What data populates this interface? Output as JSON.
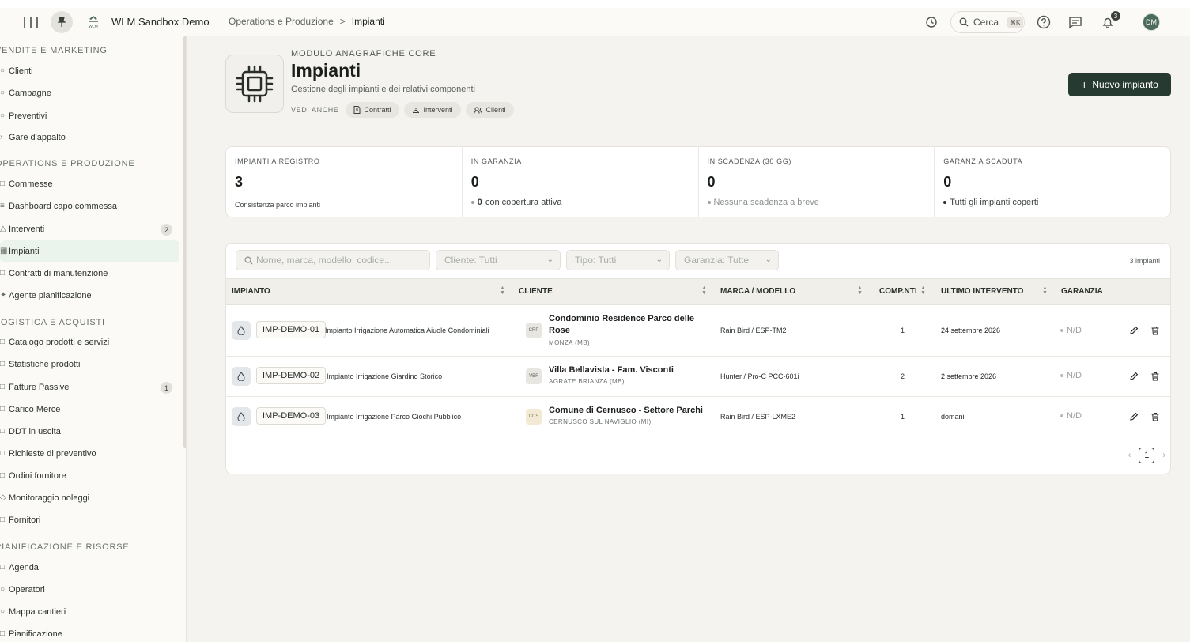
{
  "topbar": {
    "app_name": "WLM Sandbox Demo",
    "breadcrumb": [
      "Operations e Produzione",
      "Impianti"
    ],
    "breadcrumb_sep": ">",
    "search_label": "Cerca",
    "search_kbd": "⌘K",
    "notifications_count": "3",
    "avatar_initials": "DM",
    "icons": [
      "sidebar-toggle-icon",
      "pin-icon",
      "logo",
      "history-icon",
      "search-icon",
      "help-icon",
      "chat-icon",
      "bell-icon"
    ]
  },
  "sidebar": {
    "sections": [
      {
        "title": "VENDITE E MARKETING",
        "items": [
          {
            "label": "Clienti"
          },
          {
            "label": "Campagne"
          },
          {
            "label": "Preventivi"
          },
          {
            "label": "Gare d'appalto"
          }
        ]
      },
      {
        "title": "OPERATIONS E PRODUZIONE",
        "items": [
          {
            "label": "Commesse"
          },
          {
            "label": "Dashboard capo commessa"
          },
          {
            "label": "Interventi",
            "badge": "2"
          },
          {
            "label": "Impianti",
            "active": true
          },
          {
            "label": "Contratti di manutenzione"
          },
          {
            "label": "Agente pianificazione"
          }
        ]
      },
      {
        "title": "LOGISTICA E ACQUISTI",
        "items": [
          {
            "label": "Catalogo prodotti e servizi"
          },
          {
            "label": "Statistiche prodotti"
          },
          {
            "label": "Fatture Passive",
            "badge": "1"
          },
          {
            "label": "Carico Merce"
          },
          {
            "label": "DDT in uscita"
          },
          {
            "label": "Richieste di preventivo"
          },
          {
            "label": "Ordini fornitore"
          },
          {
            "label": "Monitoraggio noleggi"
          },
          {
            "label": "Fornitori"
          }
        ]
      },
      {
        "title": "PIANIFICAZIONE E RISORSE",
        "items": [
          {
            "label": "Agenda"
          },
          {
            "label": "Operatori"
          },
          {
            "label": "Mappa cantieri"
          },
          {
            "label": "Pianificazione"
          }
        ]
      }
    ]
  },
  "header": {
    "eyebrow": "MODULO ANAGRAFICHE CORE",
    "title": "Impianti",
    "subtitle": "Gestione degli impianti e dei relativi componenti",
    "see_also_label": "VEDI ANCHE",
    "see_also": [
      "Contratti",
      "Interventi",
      "Clienti"
    ],
    "new_button": "Nuovo impianto",
    "new_button_prefix": "+"
  },
  "kpis": [
    {
      "label": "IMPIANTI A REGISTRO",
      "value": "3",
      "note": "Consistenza parco impianti"
    },
    {
      "label": "IN GARANZIA",
      "value": "0",
      "note_strong": "0",
      "note": "con copertura attiva"
    },
    {
      "label": "IN SCADENZA (30 GG)",
      "value": "0",
      "note": "Nessuna scadenza a breve"
    },
    {
      "label": "GARANZIA SCADUTA",
      "value": "0",
      "note": "Tutti gli impianti coperti"
    }
  ],
  "filters": {
    "search_placeholder": "Nome, marca, modello, codice...",
    "cliente": "Cliente: Tutti",
    "tipo": "Tipo: Tutti",
    "garanzia": "Garanzia: Tutte",
    "count": "3 impianti"
  },
  "table": {
    "headers": [
      "IMPIANTO",
      "CLIENTE",
      "MARCA / MODELLO",
      "COMP.NTI",
      "ULTIMO INTERVENTO",
      "GARANZIA"
    ],
    "rows": [
      {
        "code": "IMP-DEMO-01",
        "name": "Impianto Irrigazione Automatica Aiuole Condominiali",
        "client_badge": "CRP",
        "client": "Condominio Residence Parco delle Rose",
        "location": "MONZA (MB)",
        "brand": "Rain Bird / ESP-TM2",
        "comp": "1",
        "last": "24 settembre 2026",
        "warranty": "N/D"
      },
      {
        "code": "IMP-DEMO-02",
        "name": "Impianto Irrigazione Giardino Storico",
        "client_badge": "VBF",
        "client": "Villa Bellavista - Fam. Visconti",
        "location": "AGRATE BRIANZA (MB)",
        "brand": "Hunter / Pro-C PCC-601i",
        "comp": "2",
        "last": "2 settembre 2026",
        "warranty": "N/D"
      },
      {
        "code": "IMP-DEMO-03",
        "name": "Impianto Irrigazione Parco Giochi Pubblico",
        "client_badge": "CCS",
        "client": "Comune di Cernusco - Settore Parchi",
        "location": "CERNUSCO SUL NAVIGLIO (MI)",
        "brand": "Rain Bird / ESP-LXME2",
        "comp": "1",
        "last": "domani",
        "warranty": "N/D"
      }
    ]
  },
  "pager": {
    "current": "1",
    "prev": "‹",
    "next": "›"
  },
  "colors": {
    "accent": "#263a31",
    "active_bg": "#eaf3ec",
    "bg": "#f4f3ef"
  }
}
